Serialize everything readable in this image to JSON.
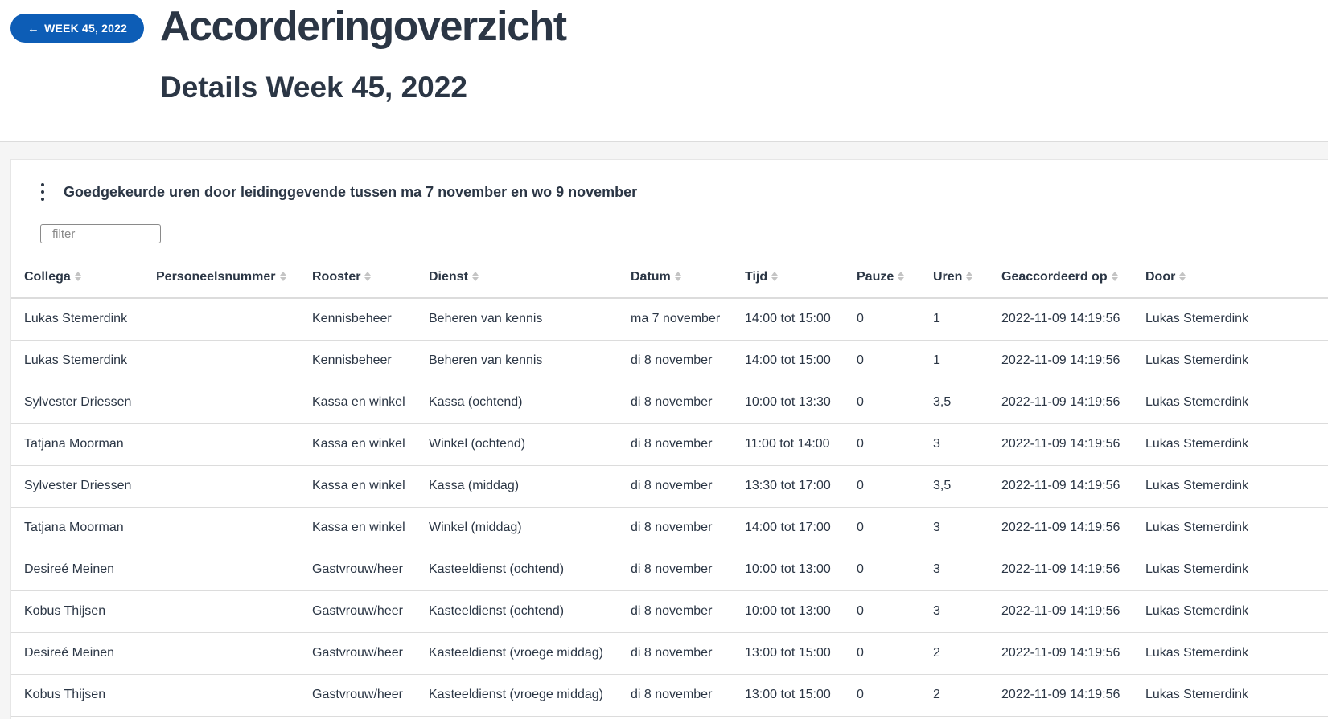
{
  "header": {
    "back_button_label": "WEEK 45, 2022",
    "title": "Accorderingoverzicht",
    "subtitle": "Details Week 45, 2022"
  },
  "card": {
    "title": "Goedgekeurde uren door leidinggevende tussen ma 7 november en wo 9 november",
    "filter_placeholder": "filter"
  },
  "table": {
    "columns": [
      "Collega",
      "Personeelsnummer",
      "Rooster",
      "Dienst",
      "Datum",
      "Tijd",
      "Pauze",
      "Uren",
      "Geaccordeerd op",
      "Door"
    ],
    "rows": [
      [
        "Lukas Stemerdink",
        "",
        "Kennisbeheer",
        "Beheren van kennis",
        "ma 7 november",
        "14:00 tot 15:00",
        "0",
        "1",
        "2022-11-09 14:19:56",
        "Lukas Stemerdink"
      ],
      [
        "Lukas Stemerdink",
        "",
        "Kennisbeheer",
        "Beheren van kennis",
        "di 8 november",
        "14:00 tot 15:00",
        "0",
        "1",
        "2022-11-09 14:19:56",
        "Lukas Stemerdink"
      ],
      [
        "Sylvester Driessen",
        "",
        "Kassa en winkel",
        "Kassa (ochtend)",
        "di 8 november",
        "10:00 tot 13:30",
        "0",
        "3,5",
        "2022-11-09 14:19:56",
        "Lukas Stemerdink"
      ],
      [
        "Tatjana Moorman",
        "",
        "Kassa en winkel",
        "Winkel (ochtend)",
        "di 8 november",
        "11:00 tot 14:00",
        "0",
        "3",
        "2022-11-09 14:19:56",
        "Lukas Stemerdink"
      ],
      [
        "Sylvester Driessen",
        "",
        "Kassa en winkel",
        "Kassa (middag)",
        "di 8 november",
        "13:30 tot 17:00",
        "0",
        "3,5",
        "2022-11-09 14:19:56",
        "Lukas Stemerdink"
      ],
      [
        "Tatjana Moorman",
        "",
        "Kassa en winkel",
        "Winkel (middag)",
        "di 8 november",
        "14:00 tot 17:00",
        "0",
        "3",
        "2022-11-09 14:19:56",
        "Lukas Stemerdink"
      ],
      [
        "Desireé Meinen",
        "",
        "Gastvrouw/heer",
        "Kasteeldienst (ochtend)",
        "di 8 november",
        "10:00 tot 13:00",
        "0",
        "3",
        "2022-11-09 14:19:56",
        "Lukas Stemerdink"
      ],
      [
        "Kobus Thijsen",
        "",
        "Gastvrouw/heer",
        "Kasteeldienst (ochtend)",
        "di 8 november",
        "10:00 tot 13:00",
        "0",
        "3",
        "2022-11-09 14:19:56",
        "Lukas Stemerdink"
      ],
      [
        "Desireé Meinen",
        "",
        "Gastvrouw/heer",
        "Kasteeldienst (vroege middag)",
        "di 8 november",
        "13:00 tot 15:00",
        "0",
        "2",
        "2022-11-09 14:19:56",
        "Lukas Stemerdink"
      ],
      [
        "Kobus Thijsen",
        "",
        "Gastvrouw/heer",
        "Kasteeldienst (vroege middag)",
        "di 8 november",
        "13:00 tot 15:00",
        "0",
        "2",
        "2022-11-09 14:19:56",
        "Lukas Stemerdink"
      ]
    ]
  },
  "colors": {
    "accent": "#0d5db6",
    "text": "#2b3645",
    "background": "#f5f5f5"
  },
  "icons": {
    "back": "arrow-left-icon",
    "menu": "kebab-menu-icon",
    "sort": "sort-icon"
  }
}
